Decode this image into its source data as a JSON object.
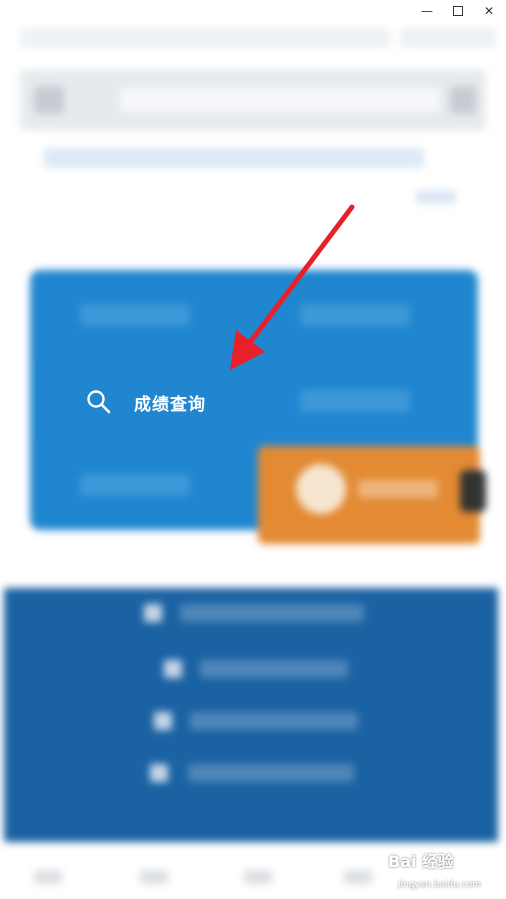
{
  "window": {
    "minimize_glyph": "—",
    "close_glyph": "✕"
  },
  "highlight": {
    "label": "成绩查询",
    "icon": "search-icon"
  },
  "annotation": {
    "arrow_color": "#e8202a"
  },
  "watermark": {
    "brand": "Bai 经验",
    "sub": "jingyan.baidu.com"
  },
  "colors": {
    "panel_blue": "#1f86cf",
    "footer_blue": "#1a62a2",
    "orange": "#e38a33"
  }
}
